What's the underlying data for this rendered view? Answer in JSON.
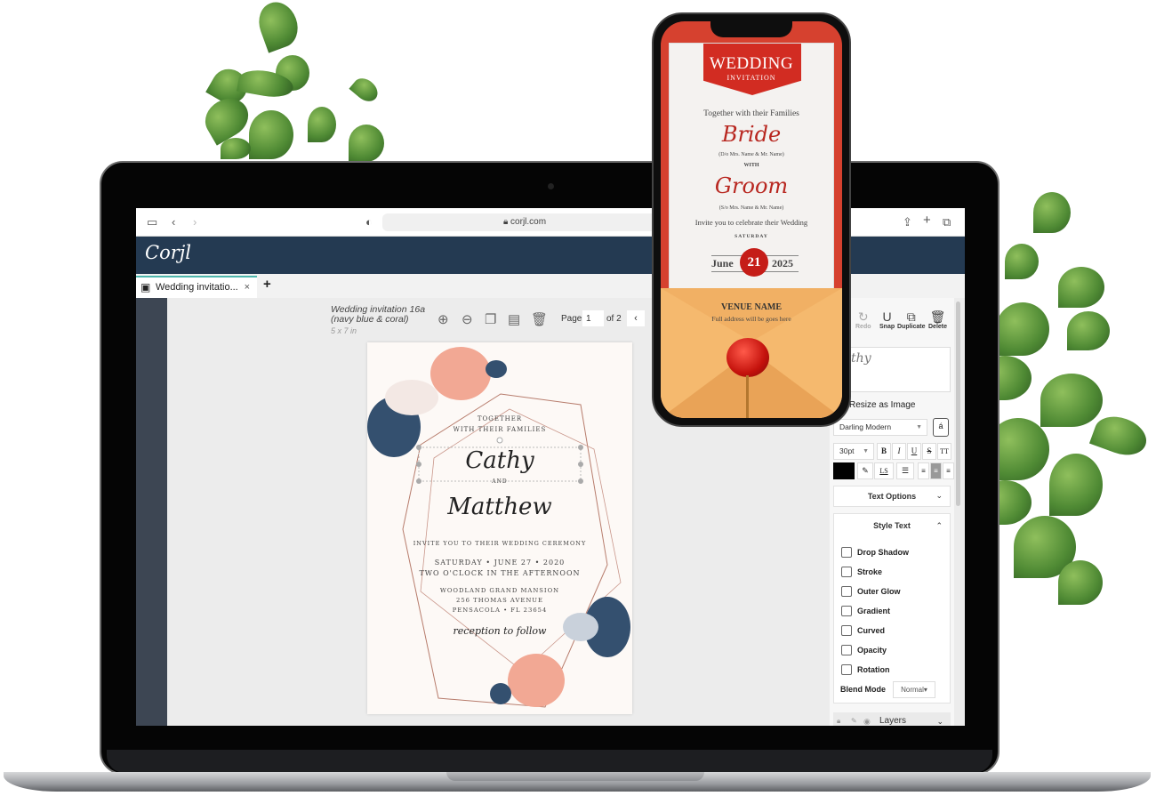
{
  "browser": {
    "url": "corjl.com",
    "icons": [
      "sidebar-icon",
      "back-icon",
      "forward-icon",
      "shield-icon",
      "lock-icon",
      "share-icon",
      "new-tab-icon",
      "tabs-icon"
    ]
  },
  "app": {
    "logo": "Corjl",
    "tab_label": "Wedding invitatio...",
    "tab_close": "×",
    "add_tab": "+"
  },
  "toolbar": {
    "doc_title_line1": "Wedding invitation 16a",
    "doc_title_line2": "(navy blue & coral)",
    "doc_size": "5 x 7 in",
    "page_label": "Page",
    "page_value": "1",
    "page_of": "of 2",
    "prev": "‹"
  },
  "invitation": {
    "line1": "TOGETHER",
    "line2": "WITH THEIR FAMILIES",
    "name1": "Cathy",
    "and": "AND",
    "name2": "Matthew",
    "invite": "INVITE YOU TO THEIR WEDDING CEREMONY",
    "date": "SATURDAY • JUNE 27 • 2020",
    "time": "TWO O'CLOCK IN THE AFTERNOON",
    "venue": "WOODLAND GRAND MANSION",
    "street": "256 THOMAS AVENUE",
    "city": "PENSACOLA • FL 23654",
    "reception": "reception to follow"
  },
  "panel": {
    "tools": [
      {
        "label": "Redo",
        "icon": "↻"
      },
      {
        "label": "Snap",
        "icon": "U"
      },
      {
        "label": "Duplicate",
        "icon": "⧉"
      },
      {
        "label": "Delete",
        "icon": "🗑"
      }
    ],
    "preview_text": "Cathy",
    "resize_label": "Resize as Image",
    "font": "Darling Modern",
    "font_size": "30pt",
    "format_buttons": [
      "B",
      "I",
      "U",
      "S",
      "TT"
    ],
    "color": "#000000",
    "ls_label": "LS",
    "text_options": "Text Options",
    "style_text": "Style Text",
    "style_options": [
      "Drop Shadow",
      "Stroke",
      "Outer Glow",
      "Gradient",
      "Curved",
      "Opacity",
      "Rotation"
    ],
    "blend_label": "Blend Mode",
    "blend_value": "Normal",
    "layers": "Layers"
  },
  "phone": {
    "title": "WEDDING",
    "subtitle": "INVITATION",
    "together": "Together with their Families",
    "bride": "Bride",
    "bride_parents": "(D/o Mrs. Name & Mr. Name)",
    "with": "WITH",
    "groom": "Groom",
    "groom_parents": "(S/o Mrs. Name & Mr. Name)",
    "invite": "Invite you to celebrate their Wedding",
    "day": "SATURDAY",
    "month": "June",
    "date": "21",
    "year": "2025",
    "venue": "VENUE NAME",
    "address": "Full address will be goes here"
  },
  "colors": {
    "header": "#243a52",
    "accent": "#4db6ac",
    "phone_red": "#d22c22"
  }
}
